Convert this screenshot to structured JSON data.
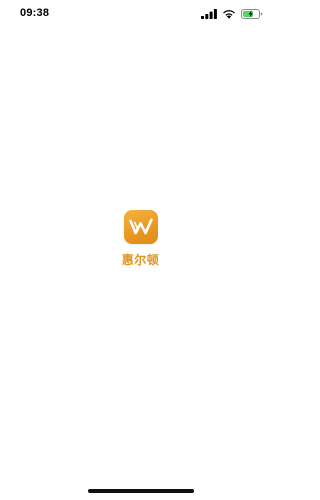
{
  "status_bar": {
    "time": "09:38",
    "icons": [
      "signal-icon",
      "wifi-icon",
      "battery-charging-icon"
    ]
  },
  "splash": {
    "app_name": "惠尔顿",
    "logo_icon": "w-logo-icon"
  },
  "colors": {
    "brand": "#e99a24",
    "brand_text": "#e39423",
    "battery": "#4cd964"
  }
}
